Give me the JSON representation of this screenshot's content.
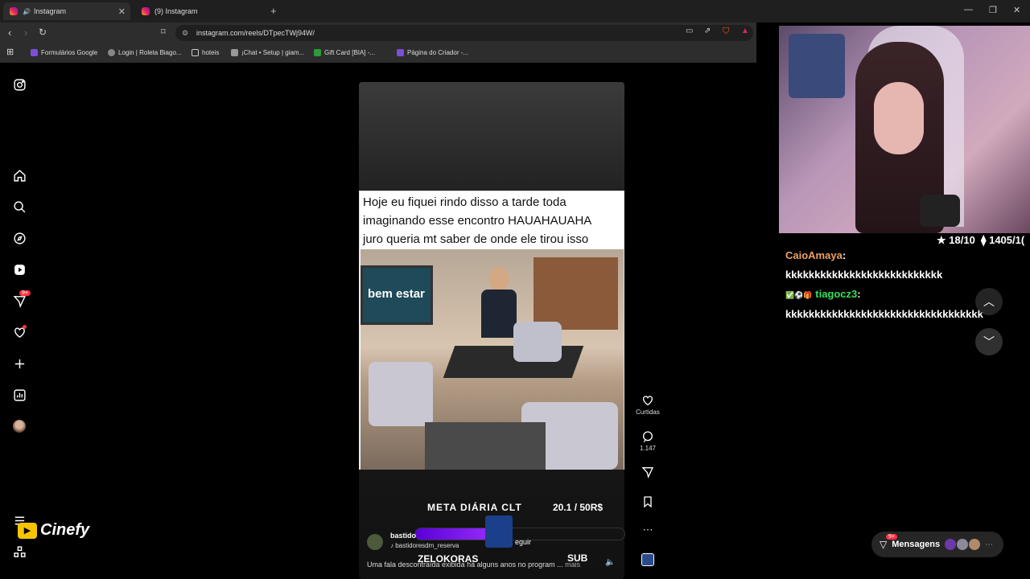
{
  "browser": {
    "tabs": [
      {
        "label": "Instagram",
        "active": true
      },
      {
        "label": "(9) Instagram",
        "active": false
      }
    ],
    "url": "instagram.com/reels/DTpecTWj94W/",
    "bookmarks": [
      {
        "label": "Formulários Google",
        "color": "#7b4fd6"
      },
      {
        "label": "Login | Roleta Biago...",
        "color": "#888888"
      },
      {
        "label": "hoteis",
        "color": "#cccccc"
      },
      {
        "label": "¡Chat • Setup | giam...",
        "color": "#999999"
      },
      {
        "label": "Gift Card [BIA] -...",
        "color": "#2e9b3b"
      },
      {
        "label": "Página do Criador -...",
        "color": "#7b4fd6"
      }
    ]
  },
  "reel": {
    "caption_lines": [
      "Hoje eu fiquei rindo disso a tarde toda",
      "imaginando esse encontro HAUAHAUAHA",
      "juro queria mt saber de onde ele tirou isso"
    ],
    "tv_logo": "bem estar",
    "username": "bastido",
    "follow_label": "eguir",
    "audio": "bastidoresdm_reserva",
    "description": "Uma fala descontraída exibida há alguns anos no program ...",
    "more_label": "mais",
    "likes_label": "Curtidas",
    "comments_count": "1.147"
  },
  "overlay": {
    "goal_title": "META DIÁRIA CLT",
    "goal_value": "20.1 / 50R$",
    "bar_left": "ZELOKORAS",
    "bar_right": "SUB",
    "goal_progress": 0.402,
    "brand": "Cinefy",
    "chat_header_rating": "★ 18/10",
    "chat_header_count": "⧫ 1405/1(",
    "chat": [
      {
        "user": "CaioAmaya",
        "color": "#f0a060",
        "text": "kkkkkkkkkkkkkkkkkkkkkkkkkkk"
      },
      {
        "user": "tiagocz3",
        "color": "#36e05a",
        "text": "kkkkkkkkkkkkkkkkkkkkkkkkkkkkkkkkkk"
      }
    ]
  },
  "messages": {
    "label": "Mensagens",
    "badge": "9+"
  },
  "notifications_badge": "9+"
}
